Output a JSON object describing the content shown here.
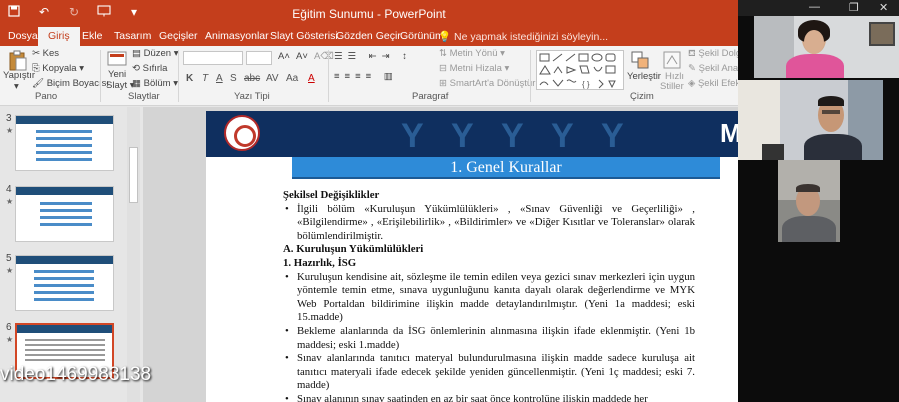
{
  "window": {
    "title": "Eğitim Sunumu - PowerPoint"
  },
  "ribbon_tabs": [
    "Dosya",
    "Giriş",
    "Ekle",
    "Tasarım",
    "Geçişler",
    "Animasyonlar",
    "Slayt Gösterisi",
    "Gözden Geçir",
    "Görünüm"
  ],
  "active_tab": "Giriş",
  "tell_me": "Ne yapmak istediğinizi söyleyin...",
  "ribbon": {
    "pano": {
      "paste": "Yapıştır",
      "cut": "Kes",
      "copy": "Kopyala",
      "format_painter": "Biçim Boyacısı",
      "label": "Pano"
    },
    "slaytlar": {
      "new_slide_1": "Yeni",
      "new_slide_2": "Slayt",
      "layout": "Düzen",
      "reset": "Sıfırla",
      "section": "Bölüm",
      "label": "Slaytlar"
    },
    "yazi_tipi": {
      "label": "Yazı Tipi",
      "buttons": [
        "K",
        "T",
        "A",
        "S",
        "abc",
        "AV",
        "Aa",
        "A"
      ]
    },
    "paragraf": {
      "label": "Paragraf",
      "text_direction": "Metin Yönü",
      "align_text": "Metni Hizala",
      "smartart": "SmartArt'a Dönüştür"
    },
    "cizim": {
      "label": "Çizim",
      "arrange": "Yerleştir",
      "quick_styles_1": "Hızlı",
      "quick_styles_2": "Stiller",
      "shape_fill": "Şekil Dolgu",
      "shape_outline": "Şekil Anaha",
      "shape_effects": "Şekil Efekti"
    }
  },
  "thumbnails": [
    {
      "num": "3",
      "star": "★"
    },
    {
      "num": "4",
      "star": "★"
    },
    {
      "num": "5",
      "star": "★"
    },
    {
      "num": "6",
      "star": "★"
    }
  ],
  "slide": {
    "title": "1. Genel Kurallar",
    "header_text": "M",
    "heading": "Şekilsel Değişiklikler",
    "bullet_intro": "İlgili bölüm «Kuruluşun Yükümlülükleri» , «Sınav Güvenliği ve Geçerliliği» , «Bilgilendirme» , «Erişilebilirlik» , «Bildirimler» ve «Diğer Kısıtlar ve Toleranslar» olarak bölümlendirilmiştir.",
    "section_a": "A.  Kuruluşun Yükümlülükleri",
    "sub_1": "1. Hazırlık, İSG",
    "bullets": [
      "Kuruluşun kendisine ait, sözleşme ile temin edilen veya gezici sınav merkezleri için uygun yöntemle temin etme, sınava uygunluğunu kanıta dayalı olarak değerlendirme ve MYK Web Portaldan bildirimine ilişkin madde detaylandırılmıştır. (Yeni 1a maddesi; eski 15.madde)",
      "Bekleme alanlarında da İSG önlemlerinin alınmasına ilişkin ifade eklenmiştir. (Yeni 1b maddesi; eski 1.madde)",
      "Sınav alanlarında tanıtıcı materyal bulundurulmasına ilişkin madde sadece kuruluşa ait tanıtıcı materyali ifade edecek şekilde yeniden güncellenmiştir. (Yeni 1ç maddesi; eski 7. madde)",
      "Sınav alanının sınav saatinden en az bir saat önce kontrolüne ilişkin maddede her"
    ]
  },
  "video_label": "video1469983138"
}
